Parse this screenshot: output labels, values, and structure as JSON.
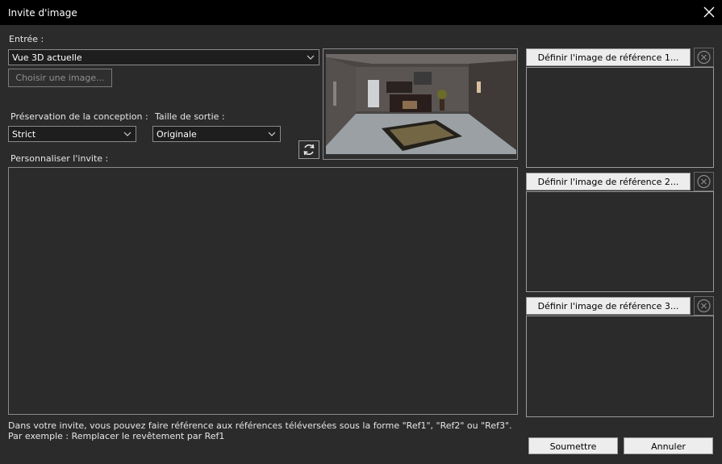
{
  "window": {
    "title": "Invite d'image"
  },
  "input": {
    "label": "Entrée :",
    "source_value": "Vue 3D actuelle",
    "choose_image_label": "Choisir une image..."
  },
  "design_preservation": {
    "label": "Préservation de la conception :",
    "value": "Strict"
  },
  "output_size": {
    "label": "Taille de sortie :",
    "value": "Originale"
  },
  "prompt": {
    "label": "Personnaliser l'invite :",
    "value": ""
  },
  "references": [
    {
      "button_label": "Définir l'image de référence 1..."
    },
    {
      "button_label": "Définir l'image de référence 2..."
    },
    {
      "button_label": "Définir l'image de référence 3..."
    }
  ],
  "hints": {
    "line1": "Dans votre invite, vous pouvez faire référence aux références téléversées sous la forme \"Ref1\", \"Ref2\" ou \"Ref3\".",
    "line2": "Par exemple : Remplacer le revêtement par Ref1"
  },
  "actions": {
    "submit_label": "Soumettre",
    "cancel_label": "Annuler"
  },
  "icons": {
    "close": "close-icon",
    "dropdown": "chevron-down-icon",
    "refresh": "refresh-icon",
    "clear": "clear-circle-icon"
  }
}
